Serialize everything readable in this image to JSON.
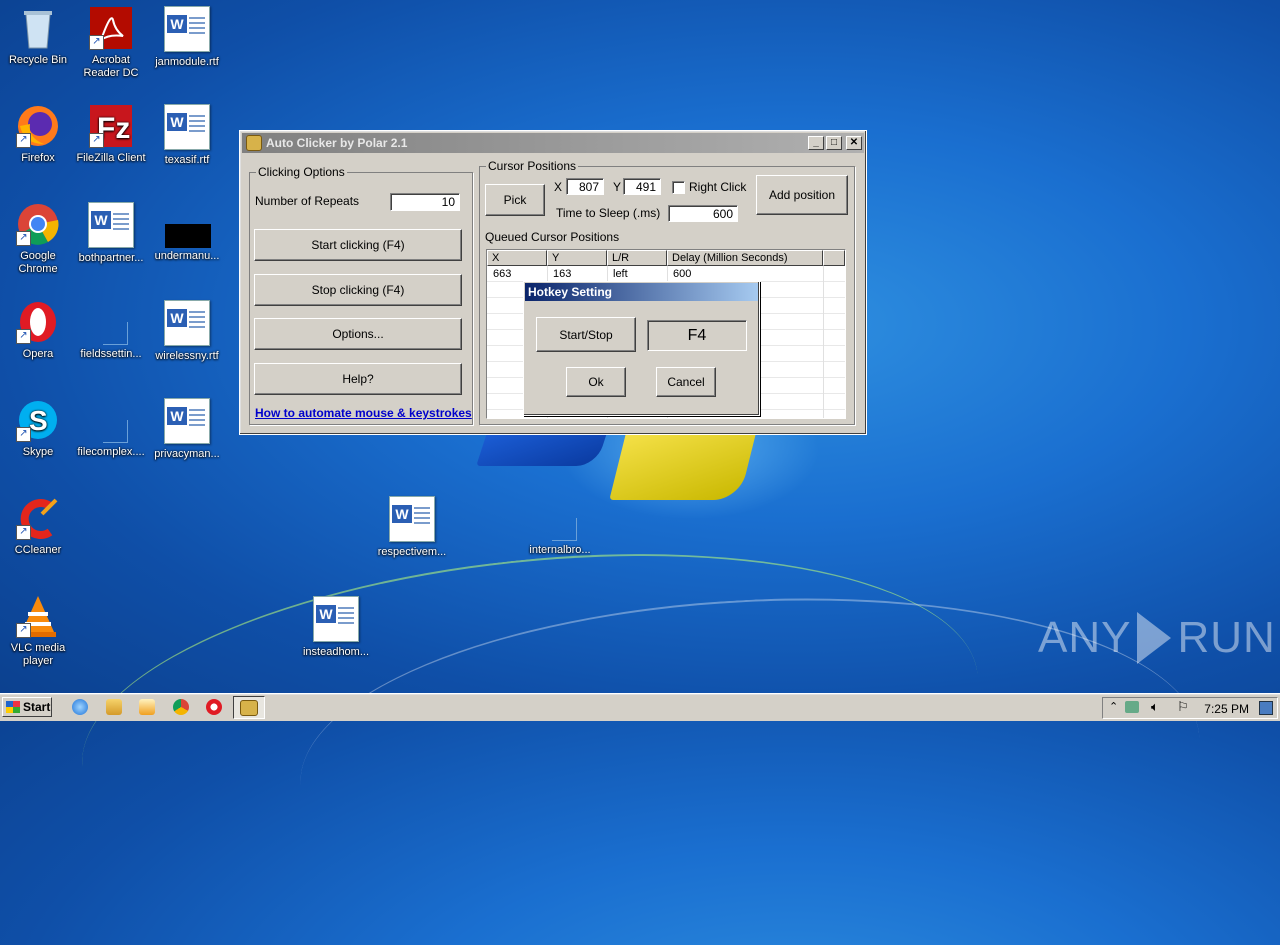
{
  "desktop": {
    "icons": [
      {
        "label": "Recycle Bin",
        "icon": "recycle-bin-icon"
      },
      {
        "label": "Acrobat Reader DC",
        "icon": "acrobat-icon"
      },
      {
        "label": "janmodule.rtf",
        "icon": "word-doc-icon"
      },
      {
        "label": "Firefox",
        "icon": "firefox-icon"
      },
      {
        "label": "FileZilla Client",
        "icon": "filezilla-icon"
      },
      {
        "label": "texasif.rtf",
        "icon": "word-doc-icon"
      },
      {
        "label": "Google Chrome",
        "icon": "chrome-icon"
      },
      {
        "label": "bothpartner...",
        "icon": "word-doc-icon"
      },
      {
        "label": "undermanu...",
        "icon": "black-file-icon"
      },
      {
        "label": "Opera",
        "icon": "opera-icon"
      },
      {
        "label": "fieldssettin...",
        "icon": "blank-file-icon"
      },
      {
        "label": "wirelessny.rtf",
        "icon": "word-doc-icon"
      },
      {
        "label": "Skype",
        "icon": "skype-icon"
      },
      {
        "label": "filecomplex....",
        "icon": "blank-file-icon"
      },
      {
        "label": "privacyman...",
        "icon": "word-doc-icon"
      },
      {
        "label": "CCleaner",
        "icon": "ccleaner-icon"
      },
      {
        "label": "VLC media player",
        "icon": "vlc-icon"
      },
      {
        "label": "respectivem...",
        "icon": "word-doc-icon"
      },
      {
        "label": "internalbro...",
        "icon": "blank-file-icon"
      },
      {
        "label": "insteadhom...",
        "icon": "word-doc-icon"
      }
    ],
    "watermark": {
      "left": "ANY",
      "right": "RUN"
    }
  },
  "app": {
    "title": "Auto Clicker by Polar 2.1",
    "clicking_options": {
      "legend": "Clicking Options",
      "repeats_label": "Number of Repeats",
      "repeats_value": "10",
      "start_label": "Start clicking (F4)",
      "stop_label": "Stop clicking (F4)",
      "options_label": "Options...",
      "help_label": "Help?",
      "link_text": "How to automate mouse & keystrokes"
    },
    "cursor_positions": {
      "legend": "Cursor Positions",
      "pick_label": "Pick",
      "x_label": "X",
      "x_value": "807",
      "y_label": "Y",
      "y_value": "491",
      "right_click_label": "Right Click",
      "right_click_checked": false,
      "sleep_label": "Time to Sleep (.ms)",
      "sleep_value": "600",
      "add_label": "Add position",
      "queue_label": "Queued Cursor Positions",
      "columns": [
        "X",
        "Y",
        "L/R",
        "Delay (Million Seconds)"
      ],
      "rows": [
        {
          "x": "663",
          "y": "163",
          "lr": "left",
          "delay": "600"
        }
      ]
    }
  },
  "hotkey_dialog": {
    "title": "Hotkey Setting",
    "start_stop_label": "Start/Stop",
    "key_value": "F4",
    "ok_label": "Ok",
    "cancel_label": "Cancel"
  },
  "taskbar": {
    "start_label": "Start",
    "clock": "7:25 PM",
    "quick_launch": [
      "ie-icon",
      "explorer-icon",
      "media-player-icon",
      "chrome-icon",
      "opera-icon",
      "autoclicker-icon"
    ]
  }
}
